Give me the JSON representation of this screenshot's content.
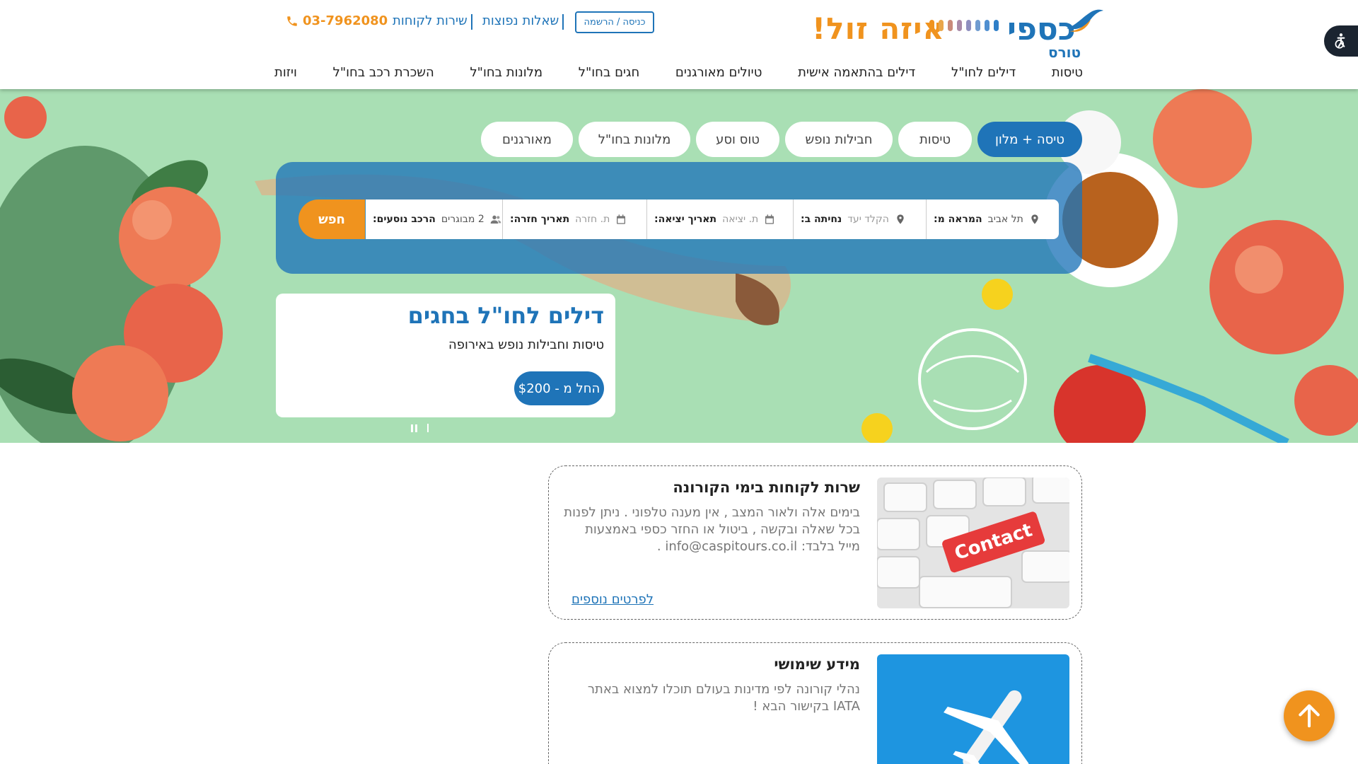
{
  "header": {
    "logo": {
      "name": "כספי",
      "sub": "טורס",
      "slogan": "איזה זול!"
    },
    "login_label": "כניסה / הרשמה",
    "faq_label": "שאלות נפוצות",
    "service_label": "שירות לקוחות",
    "phone": "03-7962080",
    "nav": [
      "טיסות",
      "דילים לחו\"ל",
      "דילים בהתאמה אישית",
      "טיולים מאורגנים",
      "חגים בחו\"ל",
      "מלונות בחו\"ל",
      "השכרת רכב בחו\"ל",
      "ויזות"
    ]
  },
  "search": {
    "tabs": [
      "טיסה + מלון",
      "טיסות",
      "חבילות נופש",
      "טוס וסע",
      "מלונות בחו\"ל",
      "מאורגנים"
    ],
    "active_tab": "טיסה + מלון",
    "from_label": "המראה מ:",
    "from_value": "תל אביב",
    "to_label": "נחיתה ב:",
    "to_placeholder": "הקלד יעד",
    "depart_label": "תאריך יציאה:",
    "depart_placeholder": "ת. יציאה",
    "return_label": "תאריך חזרה:",
    "return_placeholder": "ת. חזרה",
    "passengers_label": "הרכב נוסעים:",
    "passengers_value": "2 מבוגרים",
    "search_button": "חפש"
  },
  "hero_deal": {
    "title": "דילים לחו\"ל בחגים",
    "subtitle": "טיסות וחבילות נופש באירופה",
    "button": "החל מ - $200"
  },
  "info_cards": [
    {
      "title": "שרות לקוחות בימי הקורונה",
      "text": "בימים אלה ולאור המצב , אין מענה טלפוני . ניתן לפנות בכל שאלה ובקשה , ביטול או החזר כספי באמצעות מייל בלבד: info@caspitours.co.il .",
      "link": "לפרטים נוספים",
      "image_label": "Contact"
    },
    {
      "title": "מידע שימושי",
      "text": "נהלי קורונה לפי מדינות בעולם תוכלו למצוא באתר IATA בקישור הבא !"
    }
  ],
  "colors": {
    "brand_blue": "#1f74b8",
    "brand_orange": "#f0931e",
    "hero_green": "#a9dfb4"
  },
  "icons": [
    "phone-icon",
    "accessibility-icon",
    "location-pin-icon",
    "calendar-icon",
    "passengers-icon",
    "pause-icon",
    "arrow-up-icon"
  ]
}
